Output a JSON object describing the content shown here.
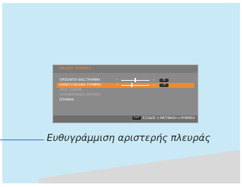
{
  "osd": {
    "title": "ΒΑΣΙΚΗ ΓΡΑΜΜΗ",
    "items": [
      {
        "label": "ΟΡΙΖΟΝΤΙΑ ΒΑΣ.ΓΡΑΜΜΗ",
        "value": "0",
        "slider_level": 0.5
      },
      {
        "label": "ΚΑΘΕΤΗ ΒΑΣΙΚΗ ΓΡΑΜΜΗ",
        "value": "-7",
        "slider_level": 0.38
      },
      {
        "label": "ΑΚΡΑ ΓΩΝΙΩΝ"
      },
      {
        "label": "ΠΑΡΑΜΟΡΦΩΣΗ ΕΙΚΟΝΑΣ"
      },
      {
        "label": "ΕΠΑΝΑΦ."
      }
    ],
    "footer": {
      "exit_key": "EXIT",
      "text": ":ΈΞΟΔΟΣ ⇕:ΜΕΤ/ΝΗΣΗ ↔:ΡΥΘΜΙΣΗ"
    }
  },
  "caption": "Ευθυγράμμιση αριστερής πλευράς",
  "colors": {
    "screen": "#c8e9f5",
    "highlight": "#f08a2e",
    "callout": "#2b6fba"
  }
}
